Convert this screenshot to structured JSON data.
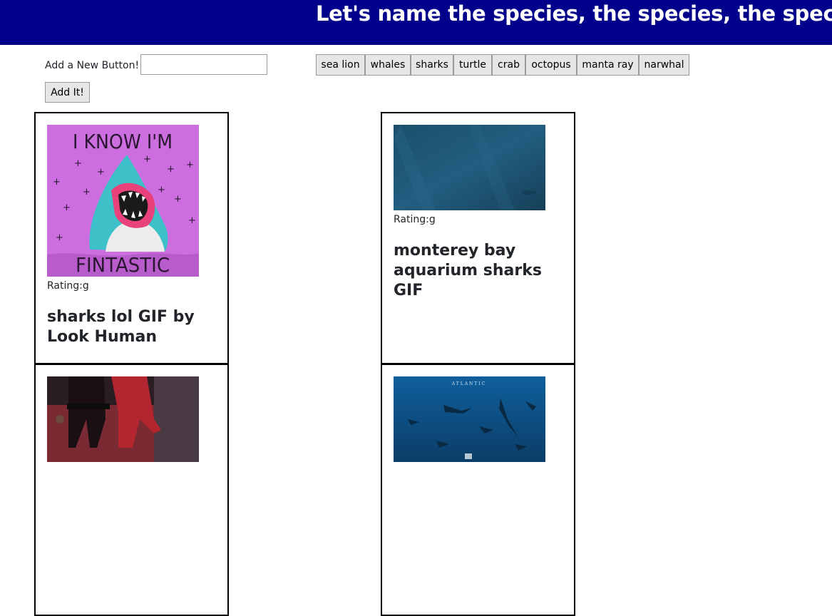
{
  "header": {
    "title": "Let's name the species, the species, the species"
  },
  "form": {
    "label": "Add a New Button!",
    "input_value": "",
    "submit_label": "Add It!"
  },
  "species_buttons": [
    "sea lion",
    "whales",
    "sharks",
    "turtle",
    "crab",
    "octopus",
    "manta ray",
    "narwhal"
  ],
  "gifs": [
    {
      "rating": "Rating:g",
      "title": "sharks lol GIF by Look Human",
      "image": "shark-fintastic-illustration",
      "image_text_top": "I KNOW I'M",
      "image_text_bottom": "FINTASTIC"
    },
    {
      "rating": "Rating:g",
      "title": "monterey bay aquarium sharks GIF",
      "image": "underwater-blue-photo"
    },
    {
      "image": "people-dancing-photo"
    },
    {
      "image": "underwater-fish-school-photo",
      "image_text_top": "ATLANTIC"
    }
  ],
  "colors": {
    "header_bg": "#00008b",
    "header_text": "#ffffff",
    "gif1_bg": "#cc6ee0"
  }
}
